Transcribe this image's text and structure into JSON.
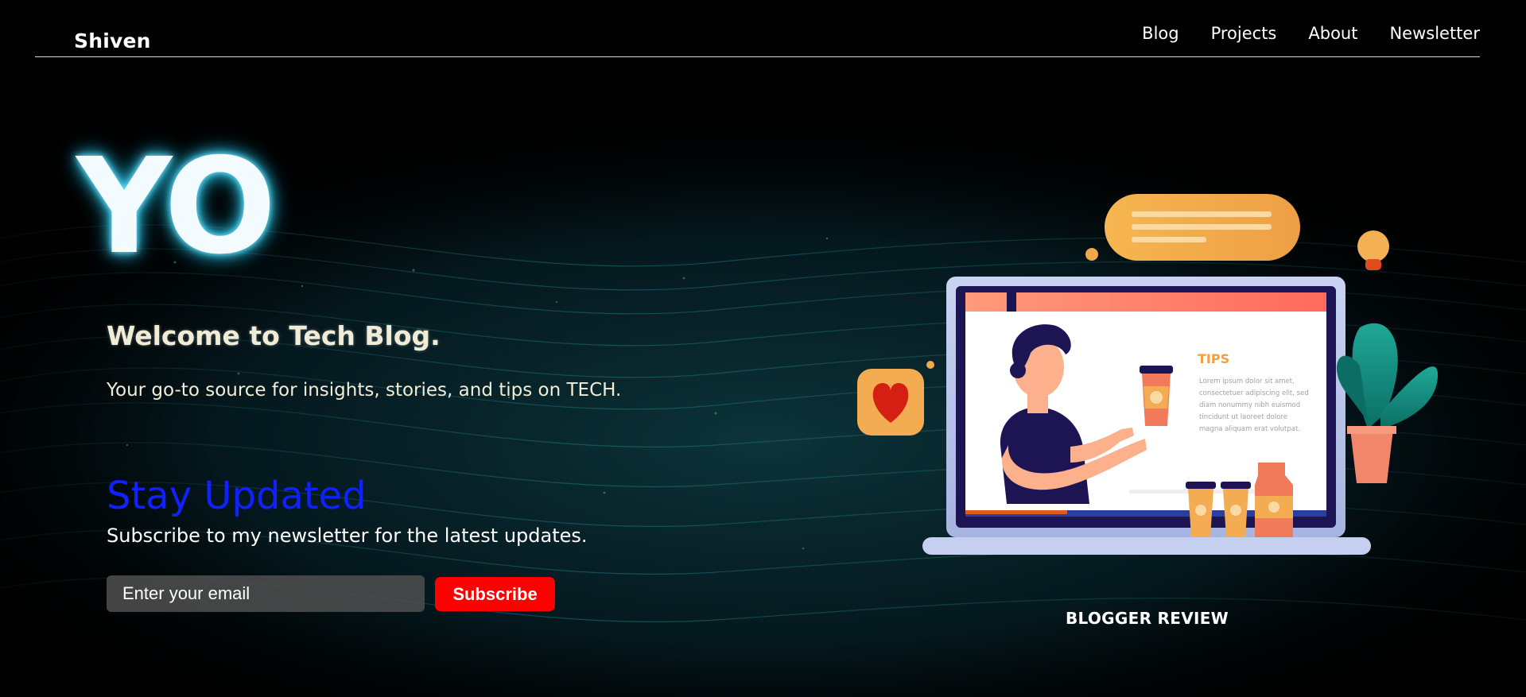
{
  "header": {
    "brand": "Shiven",
    "nav": [
      {
        "label": "Blog"
      },
      {
        "label": "Projects"
      },
      {
        "label": "About"
      },
      {
        "label": "Newsletter"
      }
    ]
  },
  "hero": {
    "big_text": "YO",
    "welcome": "Welcome to Tech Blog.",
    "tagline": "Your go-to source for insights, stories, and tips on TECH."
  },
  "newsletter": {
    "heading": "Stay Updated",
    "subtext": "Subscribe to my newsletter for the latest updates.",
    "email_placeholder": "Enter your email",
    "email_value": "",
    "button_label": "Subscribe"
  },
  "illustration": {
    "screen_heading": "TIPS",
    "screen_body": [
      "Lorem ipsum dolor sit amet,",
      "consectetuer adipiscing elit, sed",
      "diam nonummy nibh euismod",
      "tincidunt ut laoreet dolore",
      "magna aliquam erat volutpat."
    ],
    "caption": "BLOGGER REVIEW"
  },
  "colors": {
    "background": "#000000",
    "accent_blue": "#1020ff",
    "button_red": "#ff0000",
    "glow_cyan": "#2fc7e8",
    "illustration_orange": "#f0a040",
    "illustration_navy": "#1d1553"
  }
}
